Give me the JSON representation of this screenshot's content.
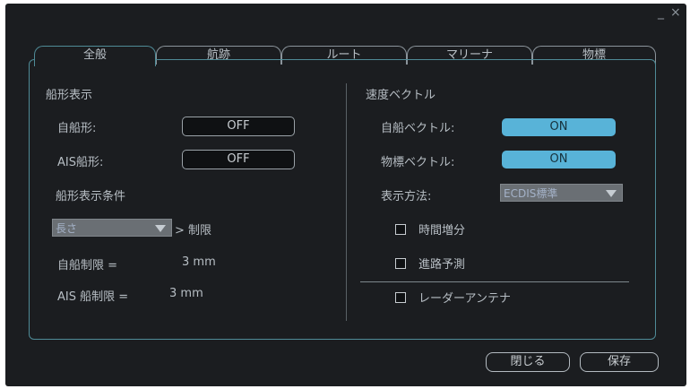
{
  "window": {
    "minimize": "_",
    "close": "×"
  },
  "tabs": [
    {
      "label": "全般"
    },
    {
      "label": "航跡"
    },
    {
      "label": "ルート"
    },
    {
      "label": "マリーナ"
    },
    {
      "label": "物標"
    }
  ],
  "left": {
    "section_title": "船形表示",
    "own_ship_label": "自船形:",
    "own_ship_value": "OFF",
    "ais_label": "AIS船形:",
    "ais_value": "OFF",
    "condition_title": "船形表示条件",
    "condition_select": "長さ",
    "limit_label": "> 制限",
    "own_limit_label": "自船制限 =",
    "own_limit_value": "3 mm",
    "ais_limit_label": "AIS 船制限 =",
    "ais_limit_value": "3 mm"
  },
  "right": {
    "section_title": "速度ベクトル",
    "own_vector_label": "自船ベクトル:",
    "own_vector_value": "ON",
    "target_vector_label": "物標ベクトル:",
    "target_vector_value": "ON",
    "display_method_label": "表示方法:",
    "display_method_value": "ECDIS標準",
    "time_increment_label": "時間増分",
    "course_prediction_label": "進路予測",
    "radar_antenna_label": "レーダーアンテナ"
  },
  "footer": {
    "close_label": "閉じる",
    "save_label": "保存"
  },
  "colors": {
    "accent_on": "#58b3d8",
    "panel_border": "#4f8b97",
    "background": "#1b1d20"
  }
}
